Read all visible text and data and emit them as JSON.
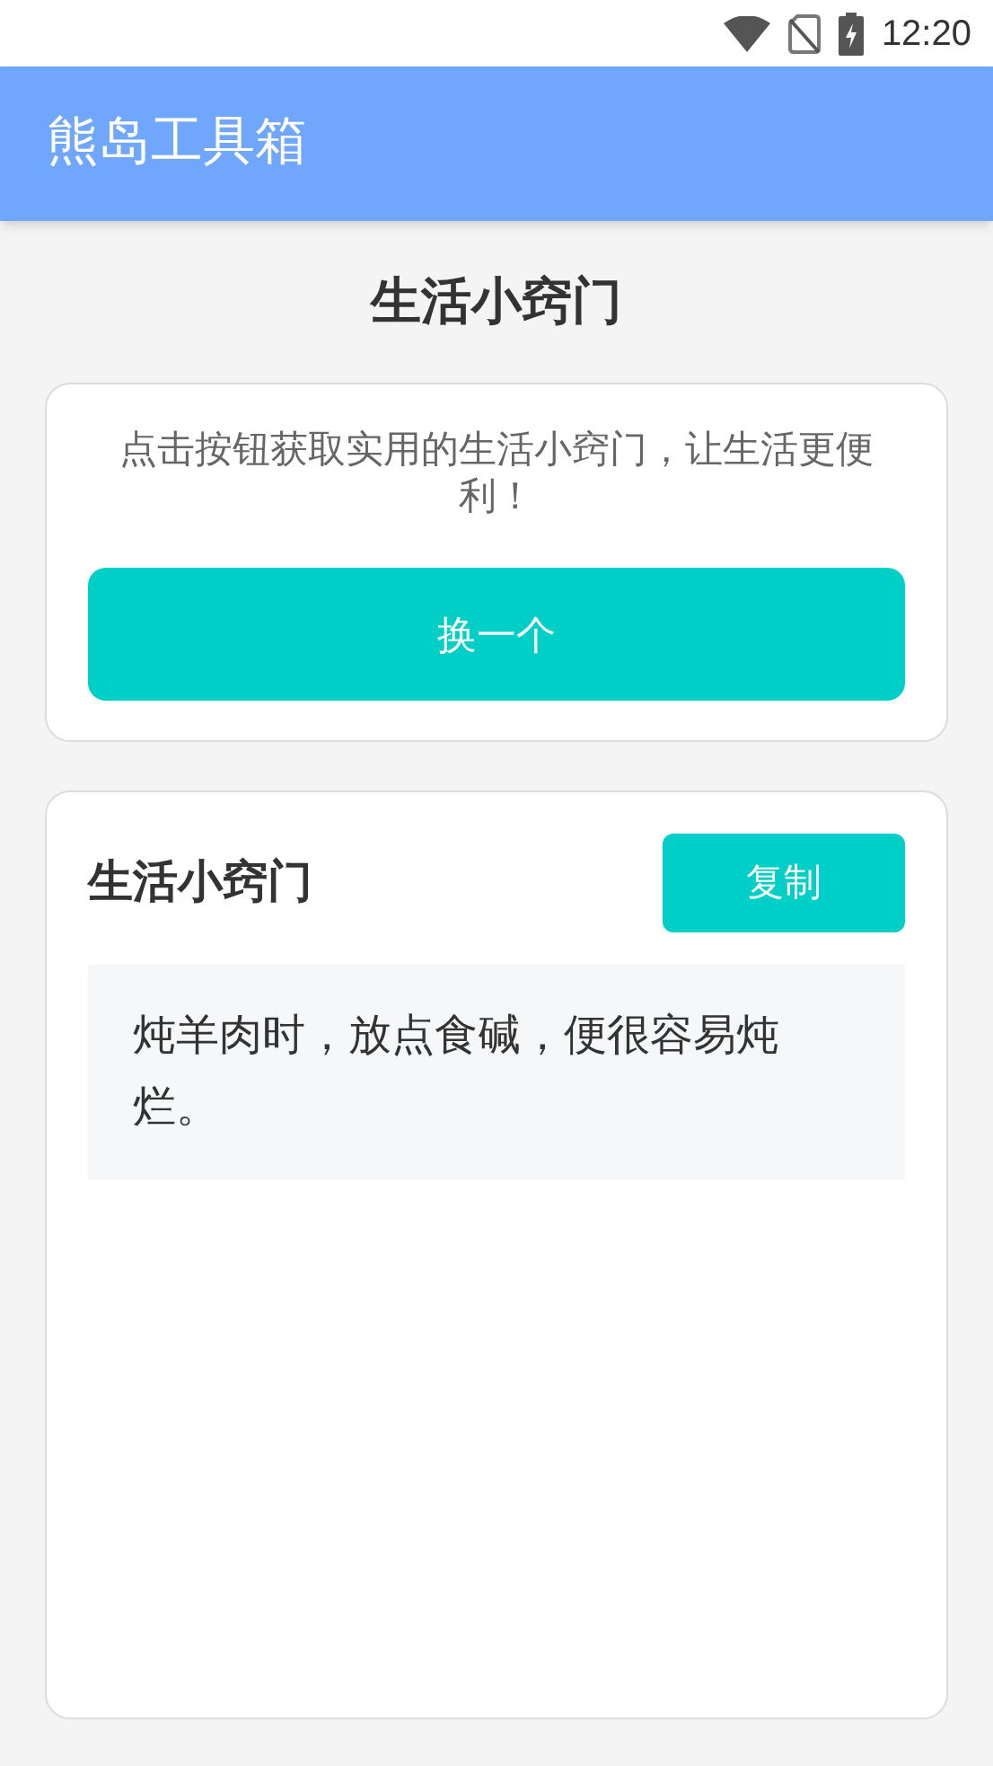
{
  "status_bar": {
    "time": "12:20"
  },
  "app_bar": {
    "title": "熊岛工具箱"
  },
  "page_title": "生活小窍门",
  "intro_card": {
    "text": "点击按钮获取实用的生活小窍门，让生活更便利！",
    "button": "换一个"
  },
  "tip_card": {
    "title": "生活小窍门",
    "copy_button": "复制",
    "tip": "炖羊肉时，放点食碱，便很容易炖烂。"
  }
}
